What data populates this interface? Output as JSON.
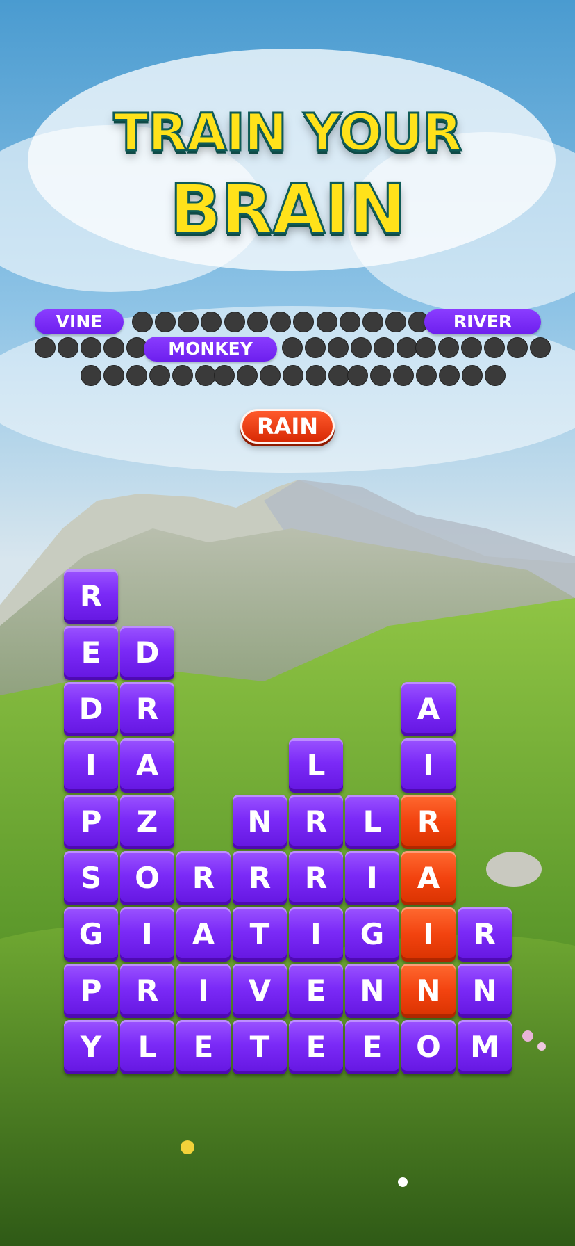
{
  "headline": {
    "line1": "TRAIN YOUR",
    "line2": "BRAIN"
  },
  "words": {
    "found": [
      "VINE",
      "RIVER",
      "MONKEY"
    ],
    "hidden_lengths": [
      4,
      4,
      5,
      5,
      6,
      6,
      6,
      6,
      7
    ]
  },
  "current_word": "RAIN",
  "board": {
    "columns": [
      [
        "R",
        "E",
        "D",
        "I",
        "P",
        "S",
        "G",
        "P",
        "Y"
      ],
      [
        "D",
        "R",
        "A",
        "Z",
        "O",
        "I",
        "R",
        "L"
      ],
      [
        "R",
        "A",
        "I",
        "E"
      ],
      [
        "N",
        "R",
        "T",
        "V",
        "T"
      ],
      [
        "L",
        "R",
        "R",
        "I",
        "E",
        "E"
      ],
      [
        "L",
        "I",
        "G",
        "N",
        "E"
      ],
      [
        "A",
        "I",
        "R",
        "A",
        "I",
        "N",
        "O"
      ],
      [
        "R",
        "N",
        "M"
      ]
    ],
    "selected": [
      [
        6,
        2
      ],
      [
        6,
        3
      ],
      [
        6,
        4
      ],
      [
        6,
        5
      ]
    ]
  },
  "colors": {
    "tile": "#7b2af7",
    "tile_selected": "#f2430f",
    "pill": "#7a2cf5",
    "headline": "#ffe21a",
    "headline_outline": "#0f5b57"
  }
}
